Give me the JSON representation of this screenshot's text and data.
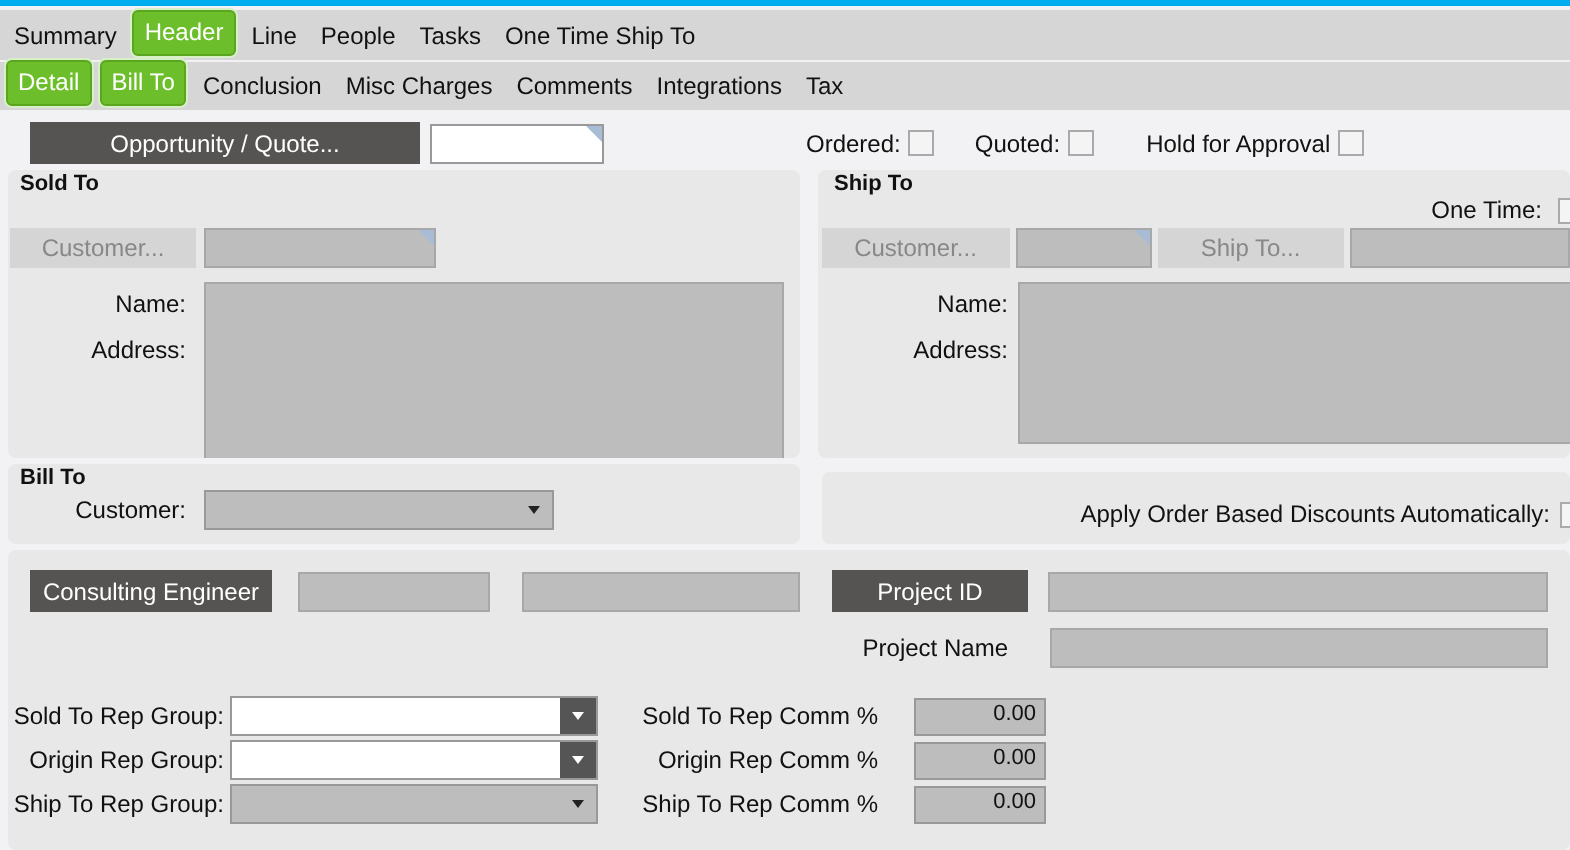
{
  "main_tabs": [
    {
      "label": "Summary",
      "selected": false
    },
    {
      "label": "Header",
      "selected": true
    },
    {
      "label": "Line",
      "selected": false
    },
    {
      "label": "People",
      "selected": false
    },
    {
      "label": "Tasks",
      "selected": false
    },
    {
      "label": "One Time Ship To",
      "selected": false
    }
  ],
  "sub_tabs": [
    {
      "label": "Detail",
      "selected": true
    },
    {
      "label": "Bill To",
      "selected": true
    },
    {
      "label": "Conclusion",
      "selected": false
    },
    {
      "label": "Misc Charges",
      "selected": false
    },
    {
      "label": "Comments",
      "selected": false
    },
    {
      "label": "Integrations",
      "selected": false
    },
    {
      "label": "Tax",
      "selected": false
    }
  ],
  "top_bar": {
    "button": "Opportunity / Quote...",
    "flags": [
      {
        "label": "Ordered:",
        "checked": false
      },
      {
        "label": "Quoted:",
        "checked": false
      },
      {
        "label": "Hold for Approval",
        "checked": false
      }
    ]
  },
  "sold_to": {
    "title": "Sold To",
    "customer_button": "Customer...",
    "name_label": "Name:",
    "address_label": "Address:"
  },
  "ship_to": {
    "title": "Ship To",
    "one_time": {
      "label": "One Time:",
      "checked": false
    },
    "customer_button": "Customer...",
    "ship_to_button": "Ship To...",
    "name_label": "Name:",
    "address_label": "Address:"
  },
  "bill_to": {
    "title": "Bill To",
    "customer_label": "Customer:"
  },
  "discounts": {
    "label": "Apply Order Based Discounts Automatically:",
    "checked": false
  },
  "engineering": {
    "consulting_button": "Consulting Engineer",
    "project_id_button": "Project ID",
    "project_name_label": "Project Name"
  },
  "rep_groups": [
    {
      "label": "Sold To Rep Group:",
      "enabled": true,
      "comm_label": "Sold To Rep Comm %",
      "comm_value": "0.00"
    },
    {
      "label": "Origin Rep Group:",
      "enabled": true,
      "comm_label": "Origin Rep Comm %",
      "comm_value": "0.00"
    },
    {
      "label": "Ship To Rep Group:",
      "enabled": false,
      "comm_label": "Ship To Rep Comm %",
      "comm_value": "0.00"
    }
  ]
}
